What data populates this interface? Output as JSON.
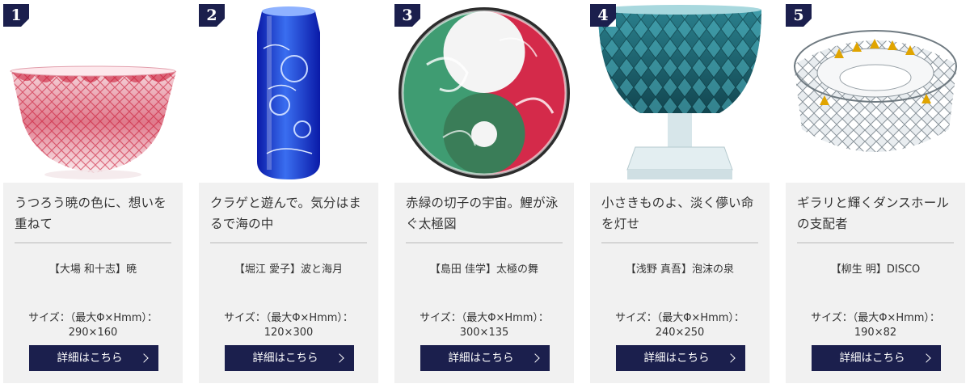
{
  "cards": [
    {
      "rank": "1",
      "title": "うつろう暁の色に、想いを重ねて",
      "artist": "【大場 和十志】暁",
      "size_label": "サイズ：（最大Φ×Hmm）：",
      "size_value": "290×160",
      "button_label": "詳細はこちら",
      "image_icon": "red-cut-glass-bowl",
      "accent_color": "#c8102e"
    },
    {
      "rank": "2",
      "title": "クラゲと遊んで。気分はまるで海の中",
      "artist": "【堀江 愛子】波と海月",
      "size_label": "サイズ：（最大Φ×Hmm）：",
      "size_value": "120×300",
      "button_label": "詳細はこちら",
      "image_icon": "blue-jellyfish-vase",
      "accent_color": "#1230c8"
    },
    {
      "rank": "3",
      "title": "赤緑の切子の宇宙。鯉が泳ぐ太極図",
      "artist": "【島田 佳学】太極の舞",
      "size_label": "サイズ：（最大Φ×Hmm）：",
      "size_value": "300×135",
      "button_label": "詳細はこちら",
      "image_icon": "red-green-koi-plate",
      "accent_color": "#d42a4a"
    },
    {
      "rank": "4",
      "title": "小さきものよ、淡く儚い命を灯せ",
      "artist": "【浅野 真吾】泡沫の泉",
      "size_label": "サイズ：（最大Φ×Hmm）：",
      "size_value": "240×250",
      "button_label": "詳細はこちら",
      "image_icon": "teal-footed-bowl",
      "accent_color": "#1f6b78"
    },
    {
      "rank": "5",
      "title": "ギラリと輝くダンスホールの支配者",
      "artist": "【柳生 明】DISCO",
      "size_label": "サイズ：（最大Φ×Hmm）：",
      "size_value": "190×82",
      "button_label": "詳細はこちら",
      "image_icon": "crystal-disco-bowl",
      "accent_color": "#e0a400"
    }
  ],
  "colors": {
    "badge": "#1b1f4d",
    "button": "#1b1f4d",
    "card_body": "#f1f1f1",
    "text": "#333333"
  }
}
